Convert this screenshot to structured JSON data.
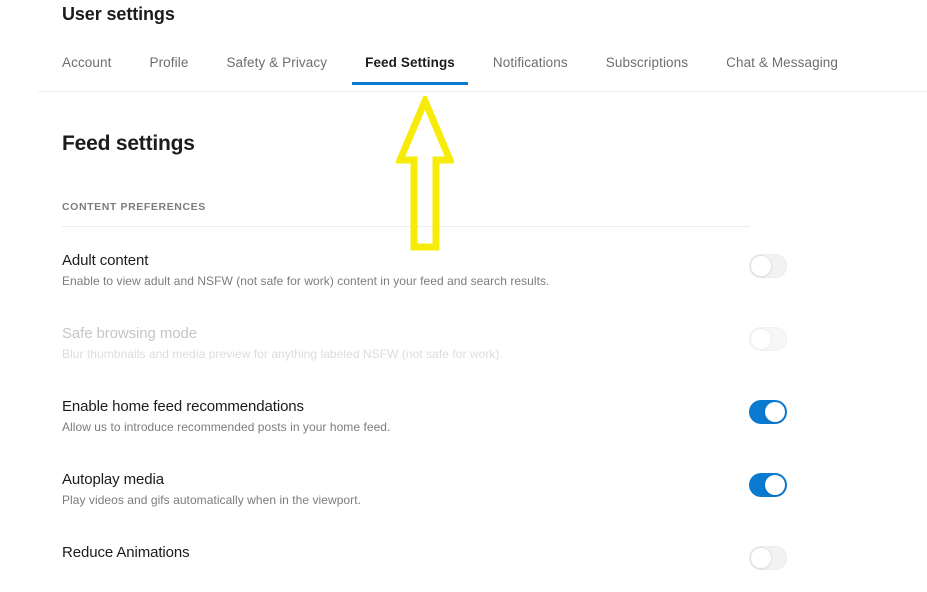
{
  "header": {
    "title": "User settings"
  },
  "tabs": [
    {
      "label": "Account",
      "active": false
    },
    {
      "label": "Profile",
      "active": false
    },
    {
      "label": "Safety & Privacy",
      "active": false
    },
    {
      "label": "Feed Settings",
      "active": true
    },
    {
      "label": "Notifications",
      "active": false
    },
    {
      "label": "Subscriptions",
      "active": false
    },
    {
      "label": "Chat & Messaging",
      "active": false
    }
  ],
  "main": {
    "heading": "Feed settings",
    "section_label": "CONTENT PREFERENCES",
    "settings": [
      {
        "title": "Adult content",
        "description": "Enable to view adult and NSFW (not safe for work) content in your feed and search results.",
        "toggle": "off",
        "disabled": false
      },
      {
        "title": "Safe browsing mode",
        "description": "Blur thumbnails and media preview for anything labeled NSFW (not safe for work).",
        "toggle": "off",
        "disabled": true
      },
      {
        "title": "Enable home feed recommendations",
        "description": "Allow us to introduce recommended posts in your home feed.",
        "toggle": "on",
        "disabled": false
      },
      {
        "title": "Autoplay media",
        "description": "Play videos and gifs automatically when in the viewport.",
        "toggle": "on",
        "disabled": false
      },
      {
        "title": "Reduce Animations",
        "description": "",
        "toggle": "off",
        "disabled": false
      }
    ]
  },
  "annotation": {
    "shape": "up-arrow-outline",
    "color": "#F7EB0A",
    "points_at": "Feed Settings"
  },
  "colors": {
    "accent": "#0a79d0",
    "text_primary": "#1c1c1c",
    "text_muted": "#7c7c7c",
    "text_disabled": "#c6c6c6",
    "toggle_off": "#f2f2f2",
    "annotation": "#F7EB0A"
  }
}
